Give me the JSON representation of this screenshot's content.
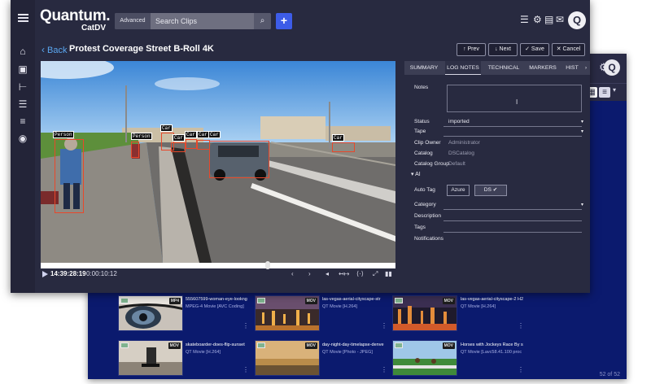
{
  "app": {
    "logo_main": "Quantum.",
    "logo_sub": "CatDV",
    "search_advanced": "Advanced",
    "search_placeholder": "Search Clips",
    "avatar_letter": "Q"
  },
  "title_bar": {
    "back_label": "Back",
    "clip_title": "Protest Coverage Street B-Roll 4K",
    "prev_label": "Prev",
    "next_label": "Next",
    "save_label": "Save",
    "cancel_label": "Cancel"
  },
  "player": {
    "timecode": "14:39:28:19",
    "duration": "0:00:10:12",
    "progress_fraction": 0.64,
    "detections": [
      "Person",
      "Person",
      "Car",
      "Car",
      "Car",
      "Car",
      "Car",
      "Car"
    ]
  },
  "tabs": [
    "SUMMARY",
    "LOG NOTES",
    "TECHNICAL",
    "MARKERS",
    "HIST"
  ],
  "active_tab": "LOG NOTES",
  "log_notes": {
    "notes_label": "Notes",
    "status_label": "Status",
    "status_value": "imported",
    "tape_label": "Tape",
    "clip_owner_label": "Clip Owner",
    "clip_owner_value": "Administrator",
    "catalog_label": "Catalog",
    "catalog_value": "DSCatalog",
    "catalog_group_label": "Catalog Group",
    "catalog_group_value": "Default",
    "ai_label": "AI",
    "auto_tag_label": "Auto Tag",
    "azure_label": "Azure",
    "ds_label": "DS",
    "category_label": "Category",
    "description_label": "Description",
    "tags_label": "Tags",
    "notifications_label": "Notifications"
  },
  "grid": {
    "pager": "52 of 52",
    "clips": [
      {
        "name": "555607599-woman-eye-lookng",
        "format": "MPEG-4 Movie [AVC Coding]"
      },
      {
        "name": "las-vegas-aerial-cityscape-str",
        "format": "QT Movie [H.264]"
      },
      {
        "name": "las-vegas-aerial-cityscape-2 H2",
        "format": "QT Movie [H.264]"
      },
      {
        "name": "skateboarder-does-flip-sunset",
        "format": "QT Movie [H.264]"
      },
      {
        "name": "day-night-day-timelapse-denve",
        "format": "QT Movie [Photo - JPEG]"
      },
      {
        "name": "Horses with Jockeys Race By s",
        "format": "QT Movie [Lavc58.41.100 proc"
      }
    ]
  },
  "colors": {
    "accent": "#3d5ce8",
    "link": "#5aa7f0",
    "panel_bg": "#282a40",
    "grid_bg": "#0b1a6e",
    "detection_box": "#e8482b"
  },
  "icons": {
    "sidebar": [
      "home-icon",
      "bag-icon",
      "hierarchy-icon",
      "list-box-icon",
      "list-icon",
      "check-circle-icon"
    ],
    "toolbar": [
      "menu-icon",
      "gear-icon",
      "badge-icon",
      "chat-icon"
    ]
  }
}
